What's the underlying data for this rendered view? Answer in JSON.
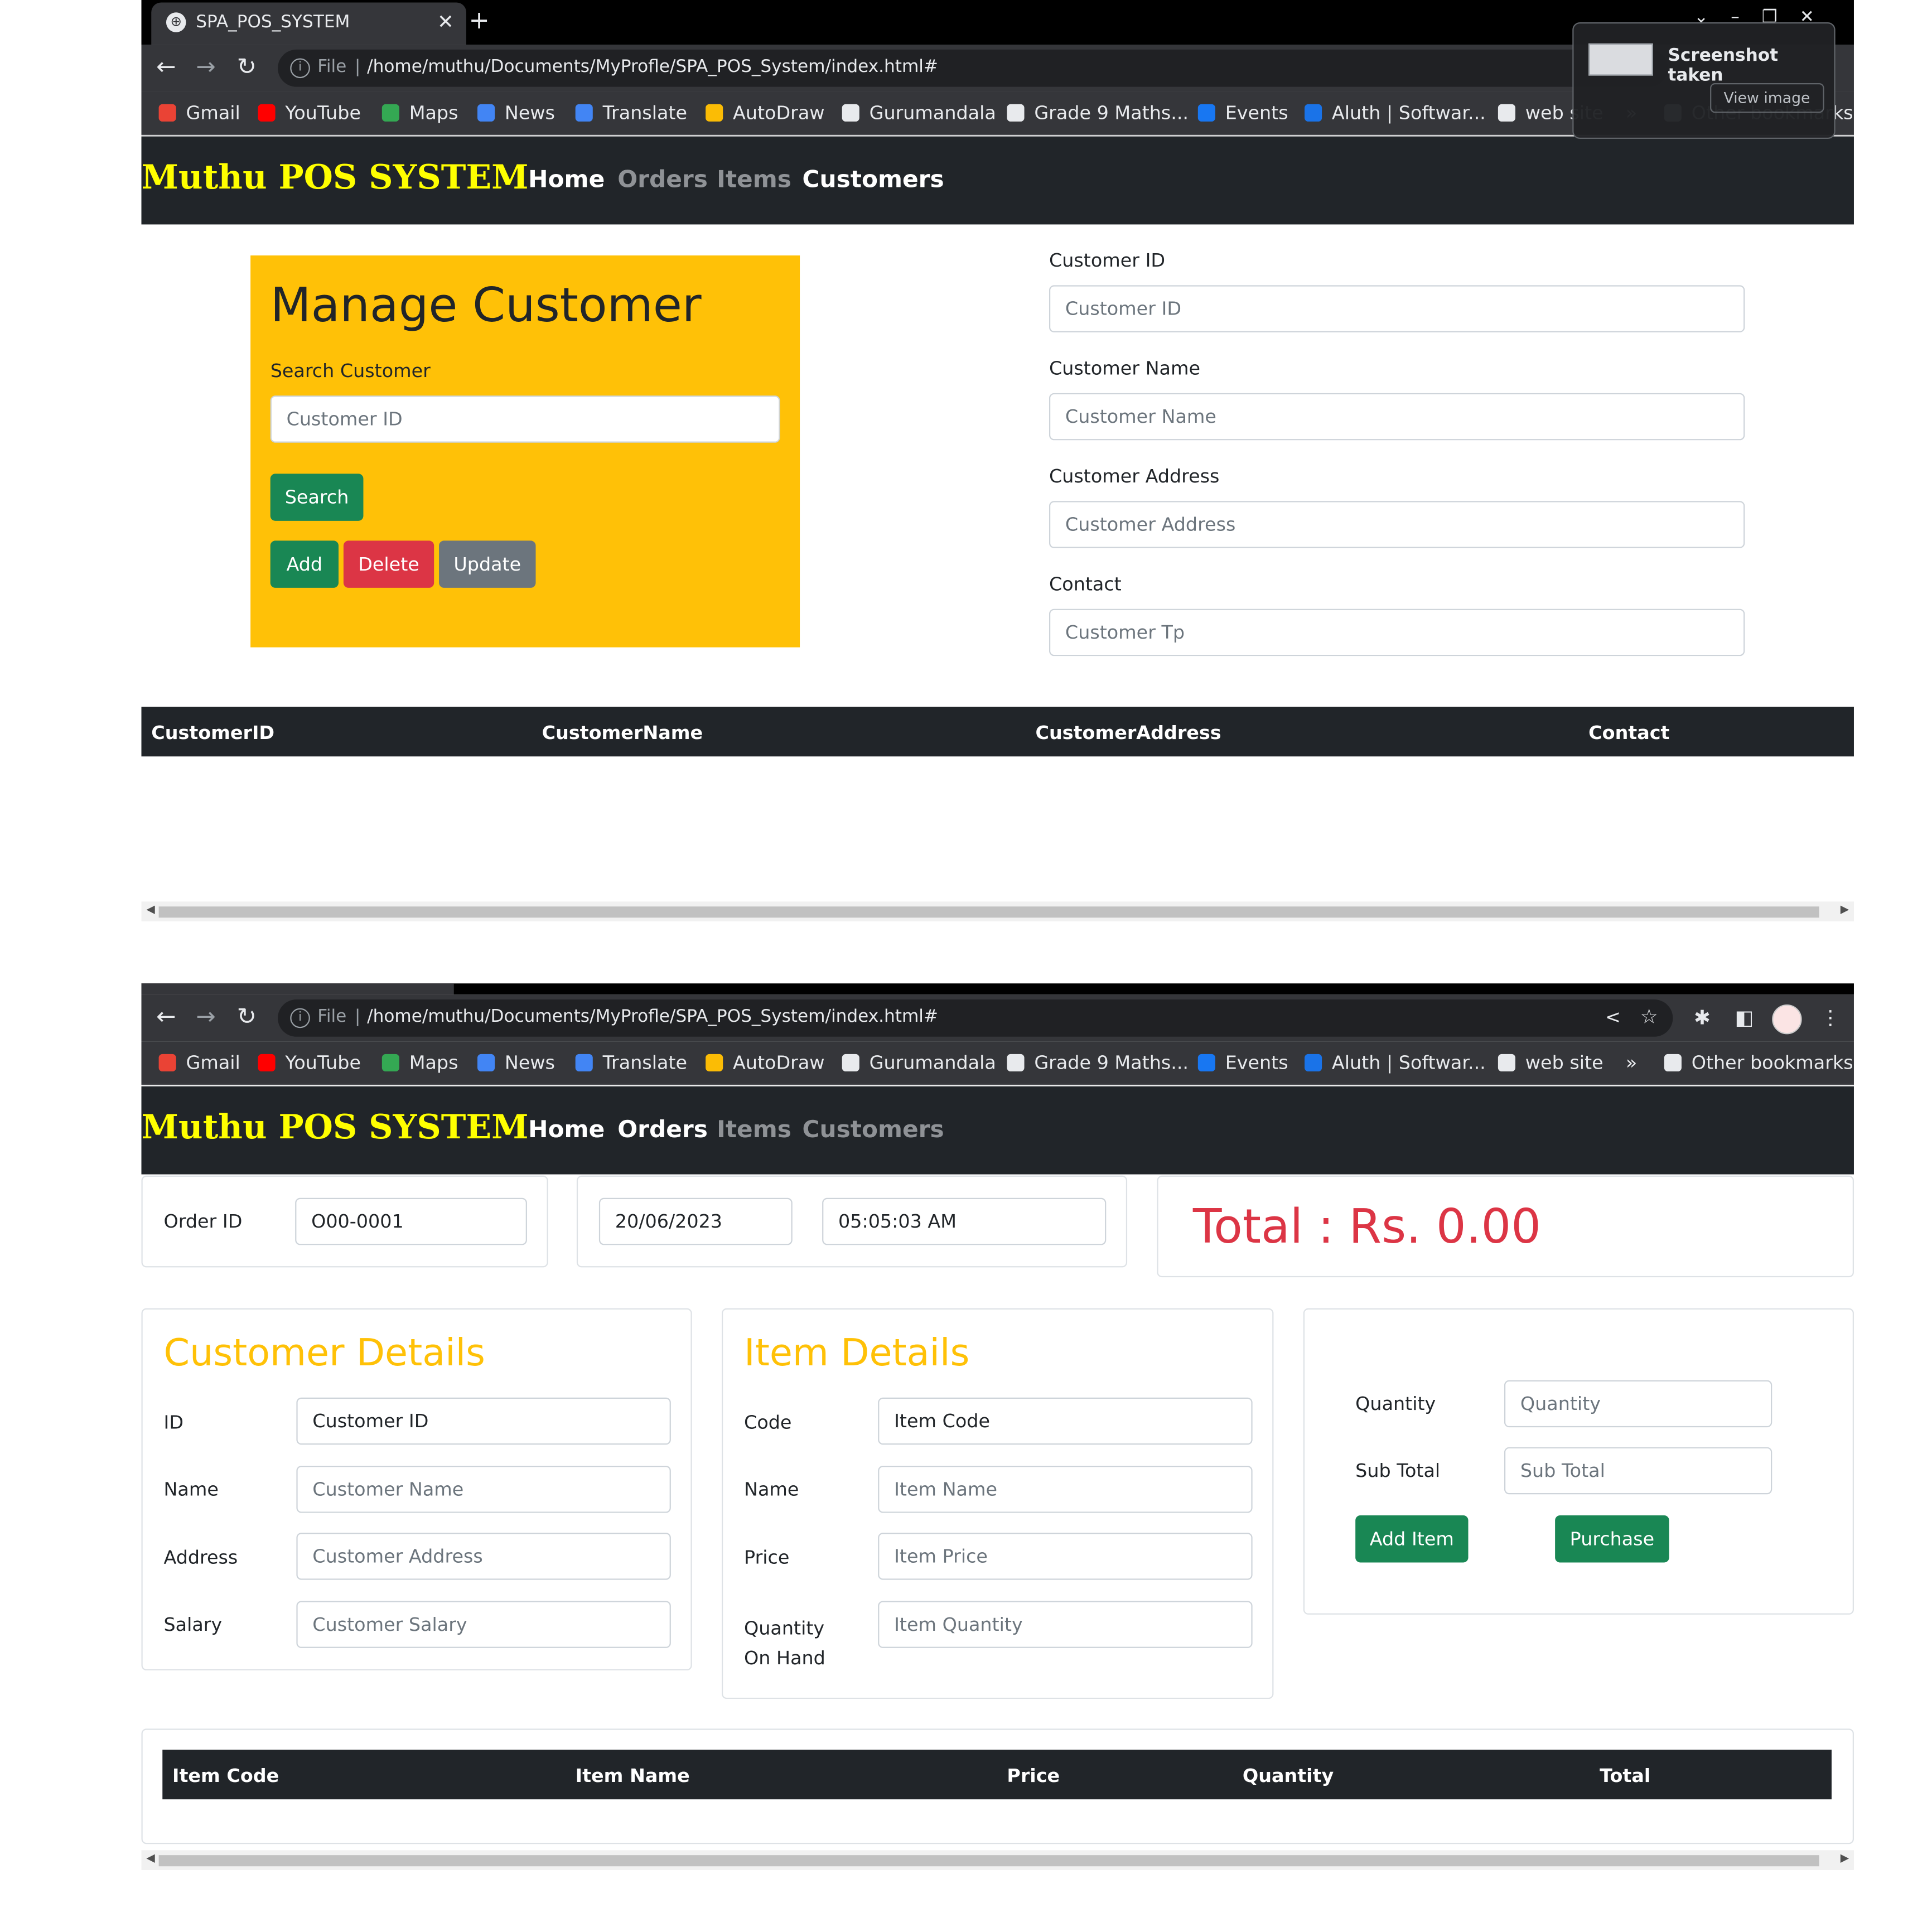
{
  "browser": {
    "tab_title": "SPA_POS_SYSTEM",
    "url_prefix": "File",
    "url": "/home/muthu/Documents/MyProfle/SPA_POS_System/index.html#",
    "bookmarks": [
      "Gmail",
      "YouTube",
      "Maps",
      "News",
      "Translate",
      "AutoDraw",
      "Gurumandala",
      "Grade 9 Maths...",
      "Events",
      "Aluth | Softwar...",
      "web site"
    ],
    "more": "»",
    "other_bookmarks": "Other bookmarks"
  },
  "toast": {
    "title": "Screenshot taken",
    "button": "View image"
  },
  "nav": {
    "brand": "Muthu POS SYSTEM",
    "links": [
      "Home",
      "Orders",
      "Items",
      "Customers"
    ]
  },
  "customer_page": {
    "panel_title": "Manage Customer",
    "search_label": "Search Customer",
    "search_placeholder": "Customer ID",
    "search_button": "Search",
    "add_button": "Add",
    "delete_button": "Delete",
    "update_button": "Update",
    "fields": [
      {
        "label": "Customer ID",
        "placeholder": "Customer ID"
      },
      {
        "label": "Customer Name",
        "placeholder": "Customer Name"
      },
      {
        "label": "Customer Address",
        "placeholder": "Customer Address"
      },
      {
        "label": "Contact",
        "placeholder": "Customer Tp"
      }
    ],
    "table_headers": [
      "CustomerID",
      "CustomerName",
      "CustomerAddress",
      "Contact"
    ]
  },
  "order_page": {
    "order_id_label": "Order ID",
    "order_id_value": "O00-0001",
    "date_value": "20/06/2023",
    "time_value": "05:05:03 AM",
    "total_text": "Total : Rs. 0.00",
    "customer_section": {
      "title": "Customer Details",
      "fields": [
        {
          "label": "ID",
          "value": "Customer ID"
        },
        {
          "label": "Name",
          "placeholder": "Customer Name"
        },
        {
          "label": "Address",
          "placeholder": "Customer Address"
        },
        {
          "label": "Salary",
          "placeholder": "Customer Salary"
        }
      ]
    },
    "item_section": {
      "title": "Item Details",
      "fields": [
        {
          "label": "Code",
          "value": "Item Code"
        },
        {
          "label": "Name",
          "placeholder": "Item Name"
        },
        {
          "label": "Price",
          "placeholder": "Item Price"
        },
        {
          "label": "Quantity On Hand",
          "placeholder": "Item Quantity"
        }
      ]
    },
    "purchase_section": {
      "quantity_label": "Quantity",
      "quantity_placeholder": "Quantity",
      "subtotal_label": "Sub Total",
      "subtotal_placeholder": "Sub Total",
      "add_item_button": "Add Item",
      "purchase_button": "Purchase"
    },
    "table_headers": [
      "Item Code",
      "Item Name",
      "Price",
      "Quantity",
      "Total"
    ]
  },
  "colors": {
    "brand": "#ffff00",
    "navbar": "#212529",
    "panel_yellow": "#ffc107",
    "success": "#198754",
    "danger": "#dc3545",
    "secondary": "#6c757d",
    "total_red": "#dc3545",
    "section_title": "#ffc107"
  }
}
